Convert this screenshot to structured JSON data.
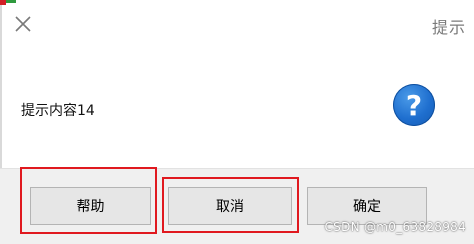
{
  "window": {
    "title": "提示",
    "close_icon": "close-icon"
  },
  "content": {
    "message": "提示内容14",
    "icon": "question-icon",
    "icon_glyph": "?"
  },
  "buttons": {
    "help": "帮助",
    "cancel": "取消",
    "ok": "确定"
  },
  "watermark": "CSDN @m0_63828984",
  "colors": {
    "highlight": "#e0191f",
    "icon_blue": "#1f6fcf",
    "footer_bg": "#f0f0f0"
  }
}
